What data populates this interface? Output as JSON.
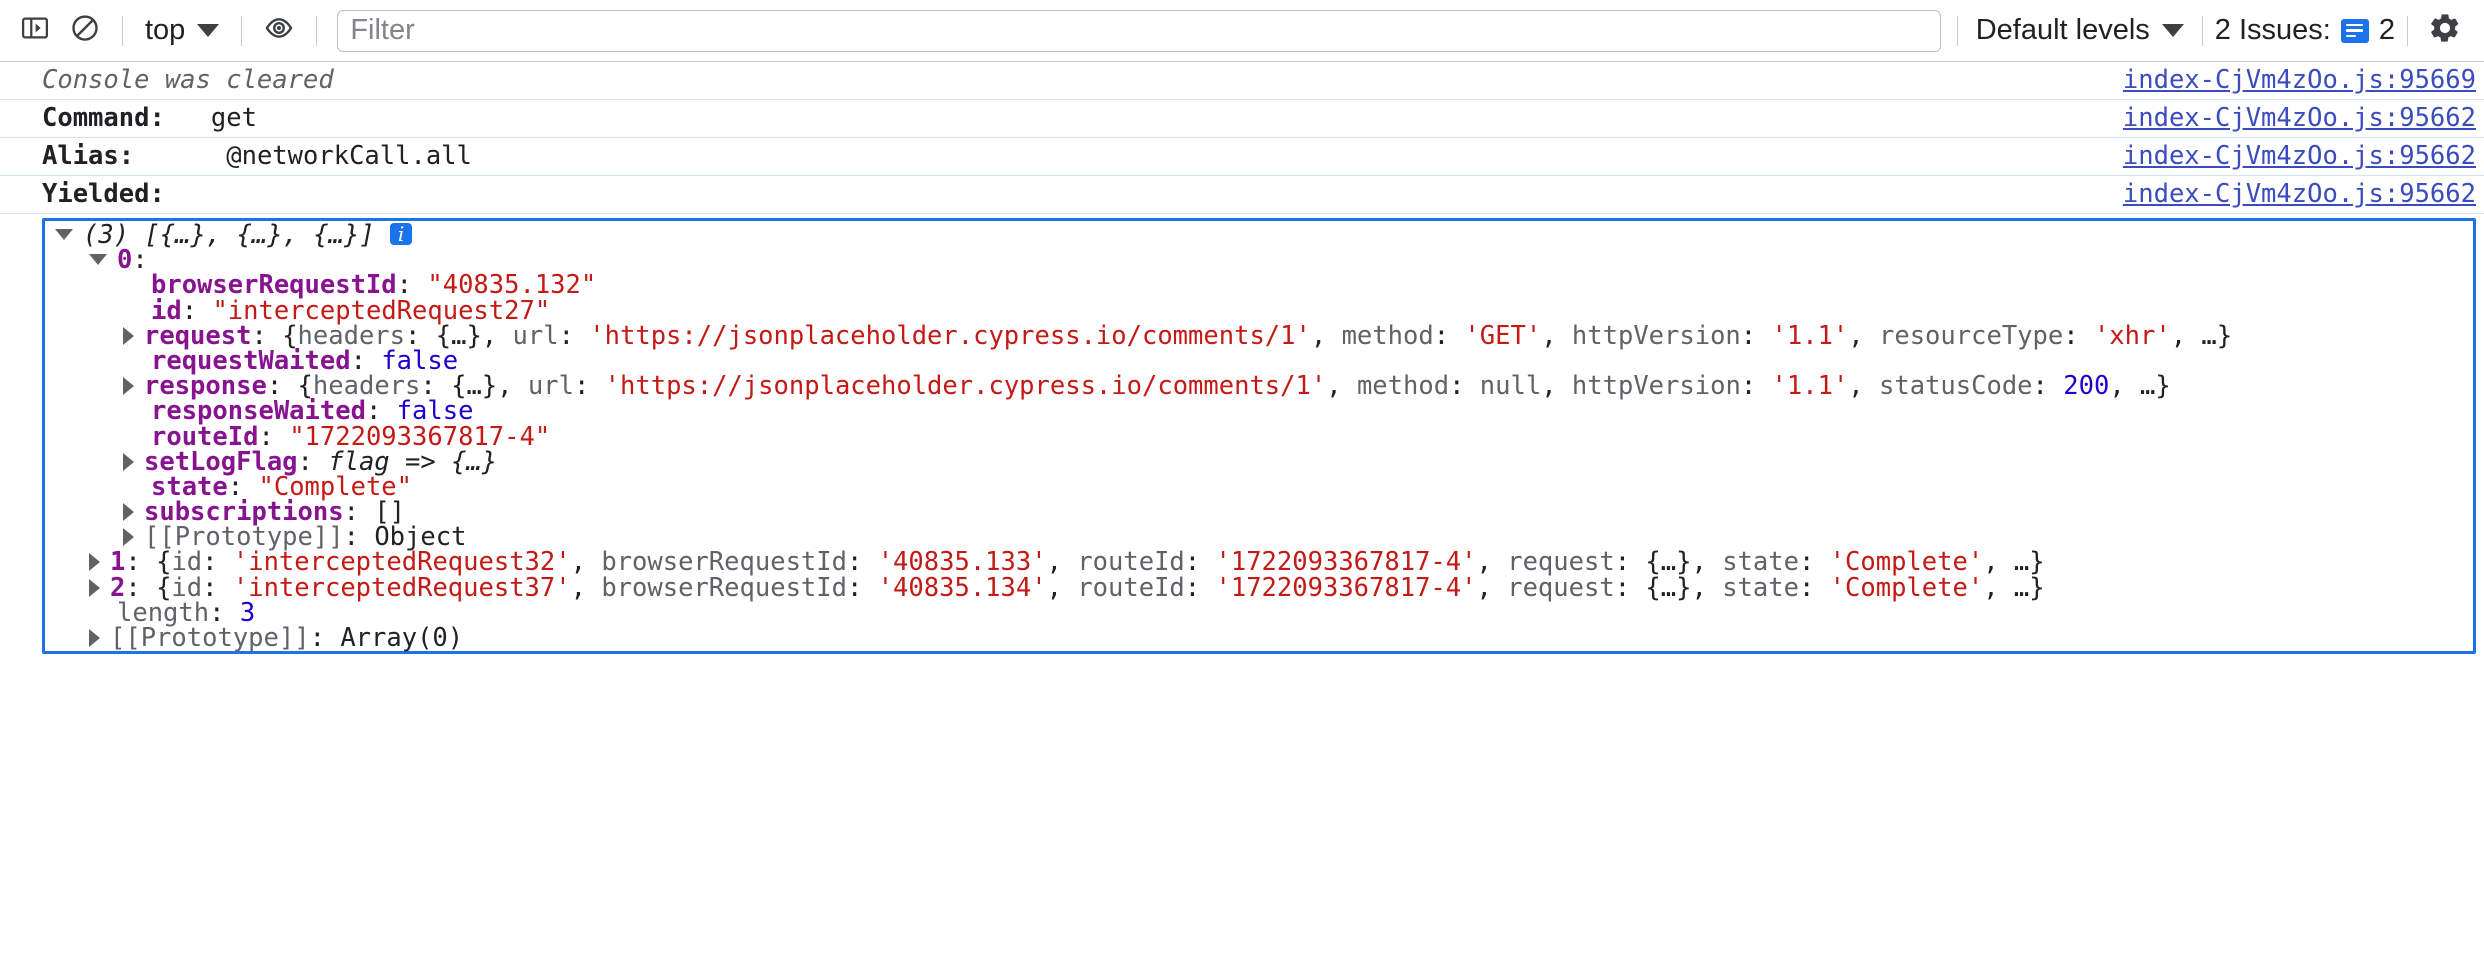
{
  "toolbar": {
    "sidebar_toggle_icon": "show-console-sidebar-icon",
    "clear_icon": "clear-console-icon",
    "context_label": "top",
    "context_caret_icon": "chevron-down-icon",
    "live_expression_icon": "eye-icon",
    "filter_placeholder": "Filter",
    "filter_value": "",
    "levels_label": "Default levels",
    "levels_caret_icon": "chevron-down-icon",
    "issues_label": "2 Issues:",
    "issues_count": "2",
    "issues_badge_icon": "issues-message-icon",
    "settings_icon": "gear-icon"
  },
  "messages": [
    {
      "kind": "cleared",
      "text": "Console was cleared",
      "source": "index-CjVm4zOo.js:95669"
    },
    {
      "kind": "labeled",
      "label": "Command:",
      "value": "get",
      "source": "index-CjVm4zOo.js:95662"
    },
    {
      "kind": "labeled",
      "label": "Alias:",
      "value": "@networkCall.all",
      "source": "index-CjVm4zOo.js:95662"
    },
    {
      "kind": "labeled",
      "label": "Yielded:",
      "value": "",
      "source": "index-CjVm4zOo.js:95662"
    }
  ],
  "object_tree": {
    "root": {
      "triangle": "open",
      "preview_count": "(3)",
      "preview_body": " [{…}, {…}, {…}] ",
      "info_badge": "i"
    },
    "item0": {
      "triangle": "open",
      "index": "0",
      "colon": ":"
    },
    "props": [
      {
        "indent": 2,
        "triangle": "none",
        "key": "browserRequestId",
        "sep": ": ",
        "value": "\"40835.132\"",
        "value_class": "str"
      },
      {
        "indent": 2,
        "triangle": "none",
        "key": "id",
        "sep": ": ",
        "value": "\"interceptedRequest27\"",
        "value_class": "str"
      },
      {
        "indent": 2,
        "triangle": "closed",
        "key": "request",
        "sep": ": ",
        "value": "",
        "value_class": "preview_request"
      },
      {
        "indent": 2,
        "triangle": "none",
        "key": "requestWaited",
        "sep": ": ",
        "value": "false",
        "value_class": "bool"
      },
      {
        "indent": 2,
        "triangle": "closed",
        "key": "response",
        "sep": ": ",
        "value": "",
        "value_class": "preview_response"
      },
      {
        "indent": 2,
        "triangle": "none",
        "key": "responseWaited",
        "sep": ": ",
        "value": "false",
        "value_class": "bool"
      },
      {
        "indent": 2,
        "triangle": "none",
        "key": "routeId",
        "sep": ": ",
        "value": "\"1722093367817-4\"",
        "value_class": "str"
      },
      {
        "indent": 2,
        "triangle": "closed",
        "key": "setLogFlag",
        "sep": ": ",
        "value": "flag => {…}",
        "value_class": "fn"
      },
      {
        "indent": 2,
        "triangle": "none",
        "key": "state",
        "sep": ": ",
        "value": "\"Complete\"",
        "value_class": "str"
      },
      {
        "indent": 2,
        "triangle": "closed",
        "key": "subscriptions",
        "sep": ": ",
        "value": "[]",
        "value_class": "punc"
      },
      {
        "indent": 2,
        "triangle": "closed",
        "key": "[[Prototype]]",
        "sep": ": ",
        "value": "Object",
        "value_class": "objtxt",
        "key_dim": true
      }
    ],
    "request_preview": {
      "open": "{",
      "headers_key": "headers",
      "headers_val": "{…}",
      "url_key": "url",
      "url_val": "'https://jsonplaceholder.cypress.io/comments/1'",
      "method_key": "method",
      "method_val": "'GET'",
      "httpversion_key": "httpVersion",
      "httpversion_val": "'1.1'",
      "resourcetype_key": "resourceType",
      "resourcetype_val": "'xhr'",
      "ellipsis": ", …}"
    },
    "response_preview": {
      "open": "{",
      "headers_key": "headers",
      "headers_val": "{…}",
      "url_key": "url",
      "url_val": "'https://jsonplaceholder.cypress.io/comments/1'",
      "method_key": "method",
      "method_val": "null",
      "httpversion_key": "httpVersion",
      "httpversion_val": "'1.1'",
      "statuscode_key": "statusCode",
      "statuscode_val": "200",
      "ellipsis": ", …}"
    },
    "items": [
      {
        "triangle": "closed",
        "index": "1",
        "id_key": "id",
        "id_val": "'interceptedRequest32'",
        "brid_key": "browserRequestId",
        "brid_val": "'40835.133'",
        "route_key": "routeId",
        "route_val": "'1722093367817-4'",
        "req_key": "request",
        "req_val": "{…}",
        "state_key": "state",
        "state_val": "'Complete'",
        "ellipsis": ", …}"
      },
      {
        "triangle": "closed",
        "index": "2",
        "id_key": "id",
        "id_val": "'interceptedRequest37'",
        "brid_key": "browserRequestId",
        "brid_val": "'40835.134'",
        "route_key": "routeId",
        "route_val": "'1722093367817-4'",
        "req_key": "request",
        "req_val": "{…}",
        "state_key": "state",
        "state_val": "'Complete'",
        "ellipsis": ", …}"
      }
    ],
    "length_row": {
      "key": "length",
      "value": "3"
    },
    "proto_row": {
      "triangle": "closed",
      "key": "[[Prototype]]",
      "value": "Array(0)"
    }
  },
  "colors": {
    "accent": "#1a73e8",
    "key": "#881391",
    "string": "#c41a16",
    "number": "#1c00cf",
    "link": "#3b4cc0",
    "row_divider": "#d6e2f7"
  }
}
